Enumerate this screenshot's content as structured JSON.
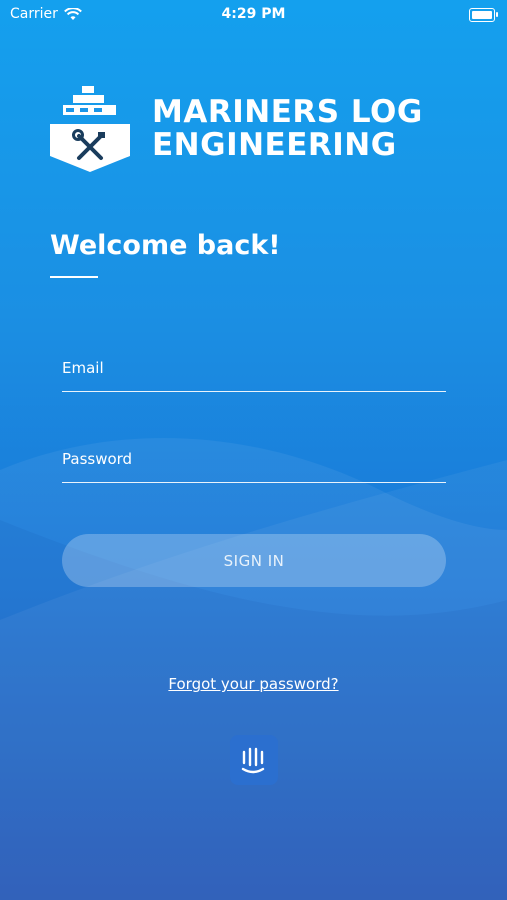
{
  "status_bar": {
    "carrier": "Carrier",
    "time": "4:29 PM"
  },
  "logo": {
    "line1": "MARINERS LOG",
    "line2": "ENGINEERING"
  },
  "welcome": {
    "title": "Welcome back!"
  },
  "form": {
    "email_label": "Email",
    "password_label": "Password",
    "signin_label": "SIGN IN",
    "forgot_label": "Forgot your password?"
  },
  "icons": {
    "logo": "ship-wrench-icon",
    "chat": "intercom-chat-icon",
    "wifi": "wifi-icon",
    "battery": "battery-icon"
  },
  "colors": {
    "background_top": "#14a0ee",
    "background_bottom": "#1f55b8",
    "text": "#ffffff"
  }
}
